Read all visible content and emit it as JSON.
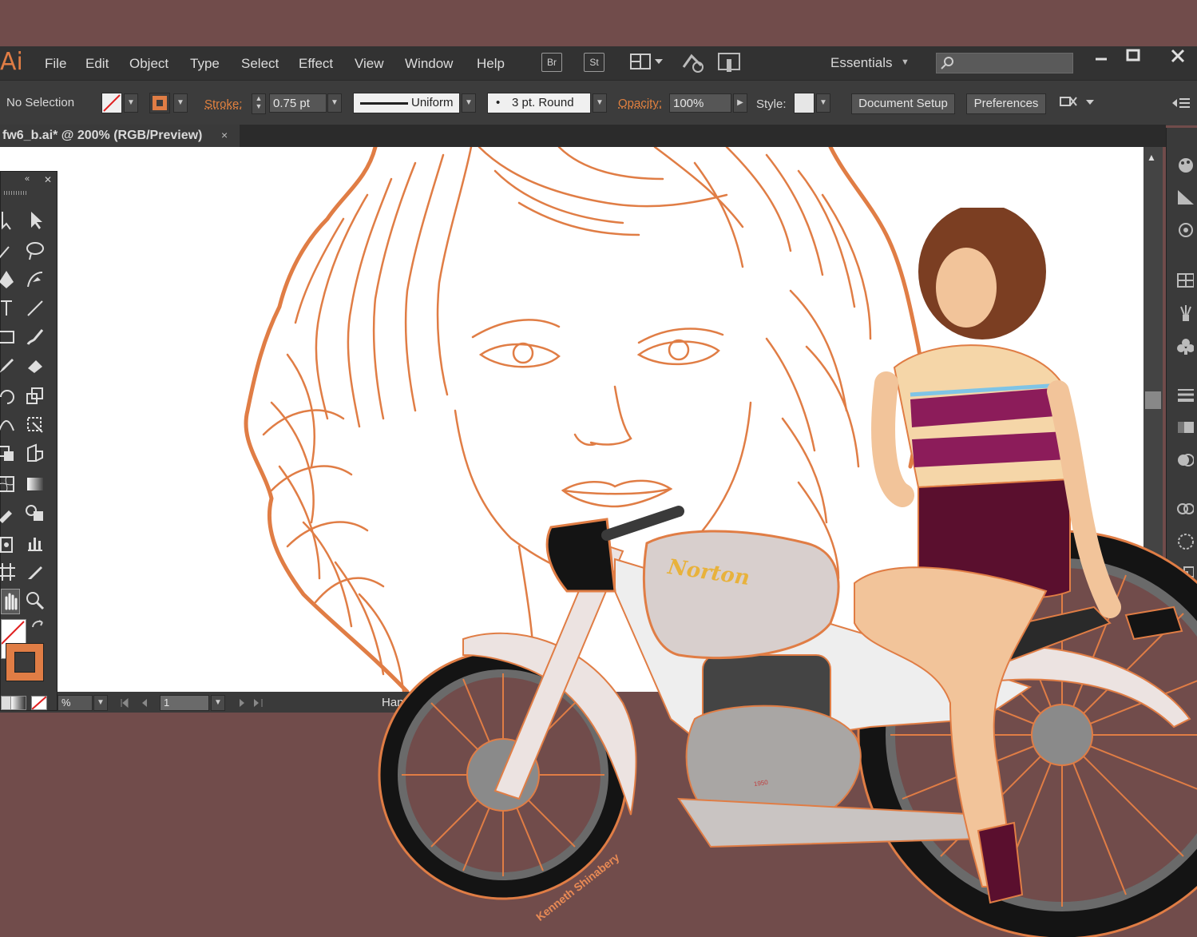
{
  "app": {
    "logo": "Ai"
  },
  "menu": {
    "items": [
      {
        "label": "File"
      },
      {
        "label": "Edit"
      },
      {
        "label": "Object"
      },
      {
        "label": "Type"
      },
      {
        "label": "Select"
      },
      {
        "label": "Effect"
      },
      {
        "label": "View"
      },
      {
        "label": "Window"
      },
      {
        "label": "Help"
      }
    ],
    "bridge_label": "Br",
    "stock_label": "St",
    "workspace": "Essentials",
    "search_placeholder": ""
  },
  "control": {
    "selection": "No Selection",
    "stroke_label": "Stroke:",
    "stroke_weight": "0.75 pt",
    "profile": "Uniform",
    "brush": "3 pt. Round",
    "brush_bullet": "•",
    "opacity_label": "Opacity:",
    "opacity_value": "100%",
    "style_label": "Style:",
    "document_setup": "Document Setup",
    "preferences": "Preferences"
  },
  "document": {
    "tab_title": "fw6_b.ai* @ 200% (RGB/Preview)",
    "close_glyph": "×"
  },
  "status": {
    "zoom": "%",
    "artboard": "1",
    "tool": "Hand"
  },
  "artwork": {
    "brand": "Norton",
    "signature": "Kenneth Shinabery",
    "year_mark": "1950"
  },
  "colors": {
    "accent": "#e07d45",
    "app_bg": "#714c4b",
    "line_art": "#e07d45"
  }
}
